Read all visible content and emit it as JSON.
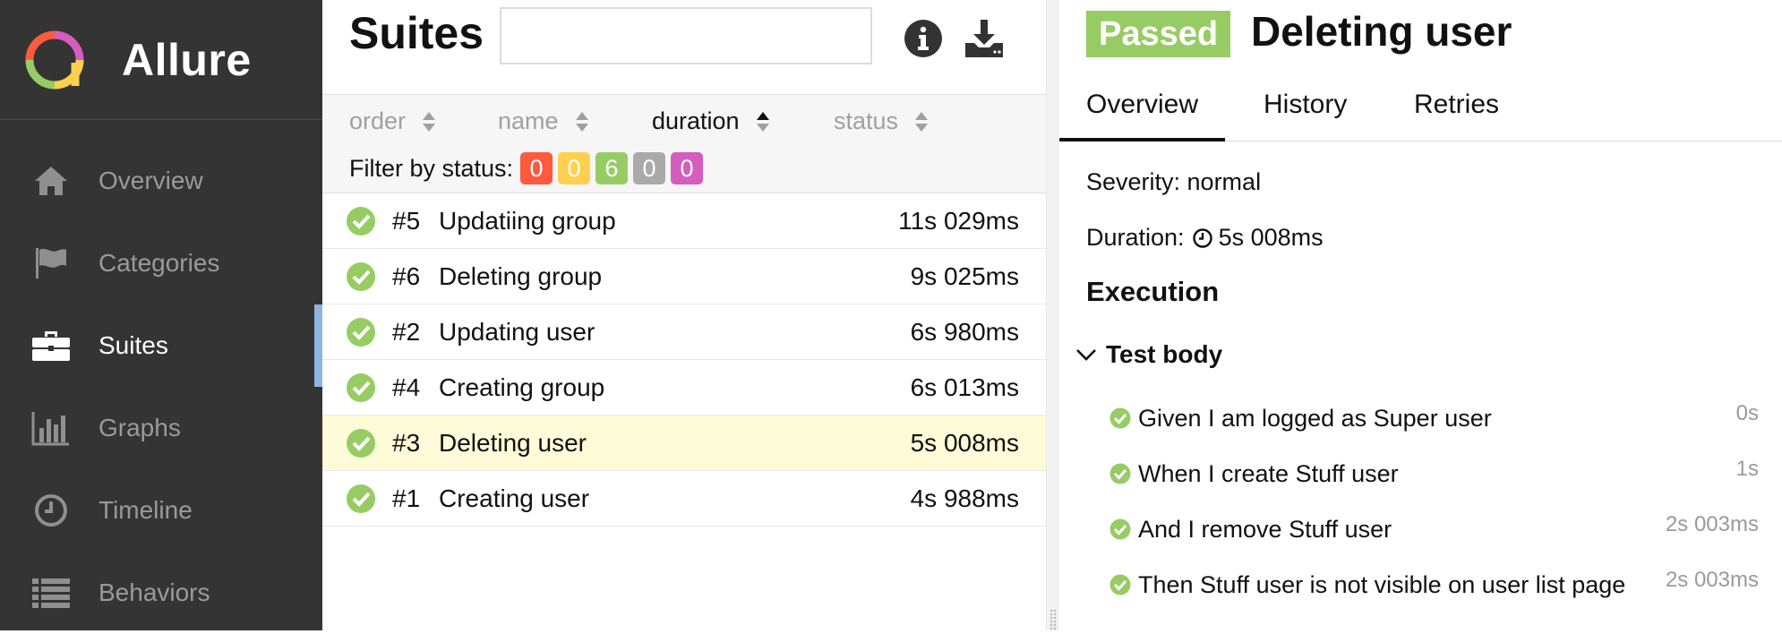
{
  "brand": {
    "name": "Allure"
  },
  "sidebar": {
    "items": [
      {
        "label": "Overview",
        "icon": "home-icon"
      },
      {
        "label": "Categories",
        "icon": "flag-icon"
      },
      {
        "label": "Suites",
        "icon": "briefcase-icon"
      },
      {
        "label": "Graphs",
        "icon": "bar-chart-icon"
      },
      {
        "label": "Timeline",
        "icon": "clock-icon"
      },
      {
        "label": "Behaviors",
        "icon": "list-icon"
      }
    ],
    "active": "Suites"
  },
  "middle": {
    "title": "Suites",
    "search": {
      "value": "",
      "placeholder": ""
    },
    "sorters": {
      "order": "order",
      "name": "name",
      "duration": "duration",
      "status": "status",
      "active": "duration"
    },
    "filter": {
      "label": "Filter by status:",
      "counts": [
        {
          "value": "0",
          "color": "#fd5a3e"
        },
        {
          "value": "0",
          "color": "#ffd050"
        },
        {
          "value": "6",
          "color": "#97cc64"
        },
        {
          "value": "0",
          "color": "#aaaaaa"
        },
        {
          "value": "0",
          "color": "#d35ebe"
        }
      ]
    },
    "rows": [
      {
        "num": "#5",
        "name": "Updatiing group",
        "duration": "11s 029ms"
      },
      {
        "num": "#6",
        "name": "Deleting group",
        "duration": "9s 025ms"
      },
      {
        "num": "#2",
        "name": "Updating user",
        "duration": "6s 980ms"
      },
      {
        "num": "#4",
        "name": "Creating group",
        "duration": "6s 013ms"
      },
      {
        "num": "#3",
        "name": "Deleting user",
        "duration": "5s 008ms"
      },
      {
        "num": "#1",
        "name": "Creating user",
        "duration": "4s 988ms"
      }
    ],
    "selected_row": "#3"
  },
  "detail": {
    "status": "Passed",
    "title": "Deleting user",
    "tabs": [
      "Overview",
      "History",
      "Retries"
    ],
    "active_tab": "Overview",
    "severity": "Severity: normal",
    "duration_label": "Duration:",
    "duration_value": "5s 008ms",
    "execution_title": "Execution",
    "test_body": "Test body",
    "steps": [
      {
        "text": "Given I am logged as Super user",
        "time": "0s"
      },
      {
        "text": "When I create Stuff user",
        "time": "1s"
      },
      {
        "text": "And I remove Stuff user",
        "time": "2s 003ms"
      },
      {
        "text": "Then Stuff user is not visible on user list page",
        "time": "2s 003ms"
      }
    ]
  },
  "colors": {
    "sidebar_bg": "#343434",
    "passed": "#97cc64",
    "selected_row": "#fefbd8",
    "active_marker": "#8fb4e0"
  }
}
